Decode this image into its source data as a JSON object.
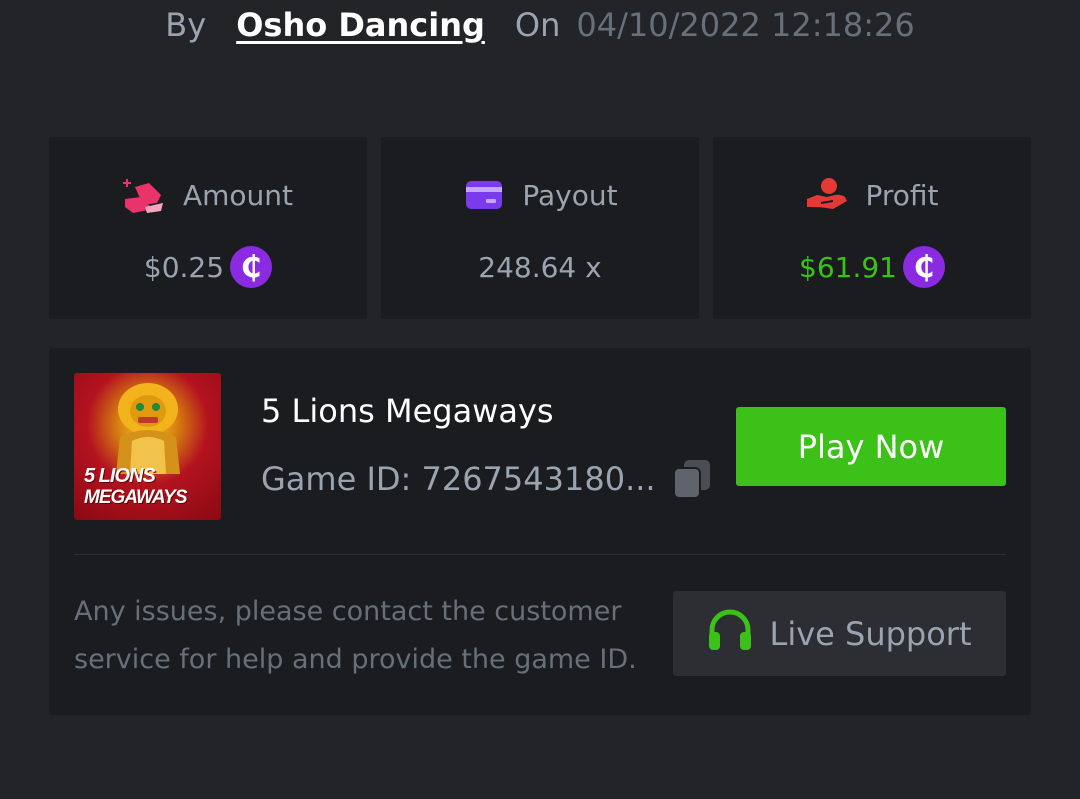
{
  "header": {
    "by_label": "By",
    "username": "Osho Dancing",
    "on_label": "On",
    "datetime": "04/10/2022 12:18:26"
  },
  "stats": {
    "amount": {
      "label": "Amount",
      "value": "$0.25",
      "icon": "bet-chips-icon",
      "currency_icon": "coin-icon"
    },
    "payout": {
      "label": "Payout",
      "value": "248.64 x",
      "icon": "card-icon"
    },
    "profit": {
      "label": "Profit",
      "value": "$61.91",
      "icon": "hand-money-icon",
      "currency_icon": "coin-icon",
      "value_color": "#3bc117"
    }
  },
  "coin_symbol": "₵",
  "game": {
    "title": "5 Lions Megaways",
    "id_text": "Game ID: 7267543180...",
    "thumbnail_line1": "5 LIONS",
    "thumbnail_line2": "MEGAWAYS",
    "play_label": "Play Now"
  },
  "support": {
    "help_text": "Any issues, please contact the customer service for help and provide the game ID.",
    "button_label": "Live Support",
    "icon": "headset-icon"
  },
  "colors": {
    "background": "#232428",
    "card": "#1b1c20",
    "accent_green": "#3bc117",
    "coin_purple": "#8a2be2",
    "amount_icon": "#e8336b",
    "payout_icon": "#7c3aed",
    "profit_icon": "#e53935"
  }
}
